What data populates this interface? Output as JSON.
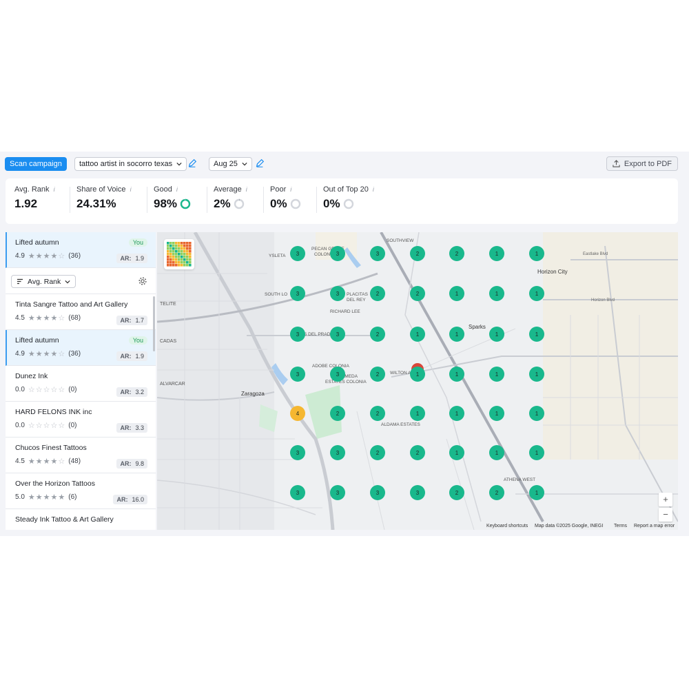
{
  "toolbar": {
    "scan_label": "Scan campaign",
    "keyword": "tattoo artist in socorro texas",
    "date": "Aug 25",
    "export_label": "Export to PDF"
  },
  "metrics": [
    {
      "label": "Avg. Rank",
      "value": "1.92"
    },
    {
      "label": "Share of Voice",
      "value": "24.31%"
    },
    {
      "label": "Good",
      "value": "98%",
      "ring_fraction": 0.98,
      "ring_color": "#19b88c"
    },
    {
      "label": "Average",
      "value": "2%",
      "ring_fraction": 0.02,
      "ring_color": "#9aa0aa"
    },
    {
      "label": "Poor",
      "value": "0%",
      "ring_fraction": 0,
      "ring_color": "#9aa0aa"
    },
    {
      "label": "Out of Top 20",
      "value": "0%",
      "ring_fraction": 0,
      "ring_color": "#9aa0aa"
    }
  ],
  "pinned": {
    "name": "Lifted autumn",
    "rating": "4.9",
    "reviews": "(36)",
    "ar": "1.9",
    "badge": "You",
    "stars": 4
  },
  "sort": {
    "label": "Avg. Rank"
  },
  "businesses": [
    {
      "name": "Tinta Sangre Tattoo and Art Gallery",
      "rating": "4.5",
      "reviews": "(68)",
      "ar": "1.7",
      "stars": 4
    },
    {
      "name": "Lifted autumn",
      "rating": "4.9",
      "reviews": "(36)",
      "ar": "1.9",
      "stars": 4,
      "badge": "You",
      "active": true
    },
    {
      "name": "Dunez Ink",
      "rating": "0.0",
      "reviews": "(0)",
      "ar": "3.2",
      "stars": 0
    },
    {
      "name": "HARD FELONS INK inc",
      "rating": "0.0",
      "reviews": "(0)",
      "ar": "3.3",
      "stars": 0
    },
    {
      "name": "Chucos Finest Tattoos",
      "rating": "4.5",
      "reviews": "(48)",
      "ar": "9.8",
      "stars": 4
    },
    {
      "name": "Over the Horizon Tattoos",
      "rating": "5.0",
      "reviews": "(6)",
      "ar": "16.0",
      "stars": 5
    },
    {
      "name": "Steady Ink Tattoo & Art Gallery",
      "rating": "",
      "reviews": "",
      "ar": "",
      "stars": 0
    }
  ],
  "ar_label": "AR:",
  "grid_ranks": [
    [
      3,
      3,
      3,
      2,
      2,
      1,
      1
    ],
    [
      3,
      3,
      2,
      2,
      1,
      1,
      1
    ],
    [
      3,
      3,
      2,
      1,
      1,
      1,
      1
    ],
    [
      3,
      3,
      2,
      1,
      1,
      1,
      1
    ],
    [
      4,
      2,
      2,
      1,
      1,
      1,
      1
    ],
    [
      3,
      3,
      2,
      2,
      1,
      1,
      1
    ],
    [
      3,
      3,
      3,
      3,
      2,
      2,
      1
    ]
  ],
  "colors": {
    "rank_good": "#19b88c",
    "rank_average": "#f5b731",
    "accent": "#1a8df0",
    "pin": "#d9473a"
  },
  "map_labels": [
    {
      "text": "SOUTHVIEW"
    },
    {
      "text": "PECAN GROVE"
    },
    {
      "text": "YSLETA"
    },
    {
      "text": "COLONIA"
    },
    {
      "text": "Horizon City"
    },
    {
      "text": "SOUTH LO"
    },
    {
      "text": "PLACITAS"
    },
    {
      "text": "DEL REY"
    },
    {
      "text": "RICHARD LEE"
    },
    {
      "text": "Sparks"
    },
    {
      "text": "S DEL PRAD"
    },
    {
      "text": "Zaragoza"
    },
    {
      "text": "ADOBE COLONIA"
    },
    {
      "text": "WILTON ACRES"
    },
    {
      "text": "ALAMEDA"
    },
    {
      "text": "ESTATES COLONIA"
    },
    {
      "text": "ALDAMA ESTATES"
    },
    {
      "text": "ATHENA WEST"
    },
    {
      "text": "ALVARCAR"
    },
    {
      "text": "CADAS"
    },
    {
      "text": "TELITE"
    },
    {
      "text": "Horizon Blvd"
    },
    {
      "text": "Eastlake Blvd"
    }
  ],
  "map_footer": {
    "shortcuts": "Keyboard shortcuts",
    "data": "Map data ©2025 Google, INEGI",
    "terms": "Terms",
    "report": "Report a map error"
  },
  "zoom": {
    "in": "+",
    "out": "−"
  }
}
